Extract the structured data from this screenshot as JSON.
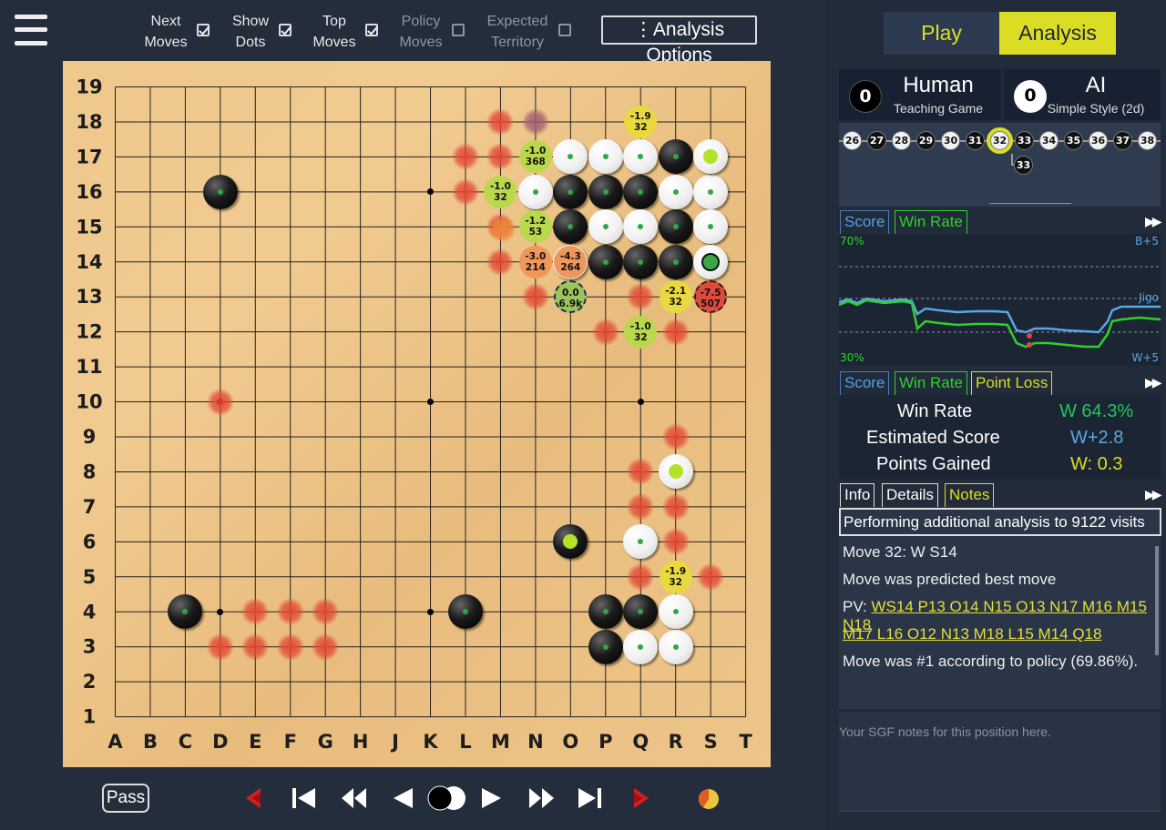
{
  "toolbar": {
    "options": [
      {
        "line1": "Next",
        "line2": "Moves",
        "checked": true
      },
      {
        "line1": "Show",
        "line2": "Dots",
        "checked": true
      },
      {
        "line1": "Top",
        "line2": "Moves",
        "checked": true
      },
      {
        "line1": "Policy",
        "line2": "Moves",
        "checked": false
      },
      {
        "line1": "Expected",
        "line2": "Territory",
        "checked": false
      }
    ],
    "analysis_options": "⋮Analysis Options"
  },
  "board": {
    "columns": [
      "A",
      "B",
      "C",
      "D",
      "E",
      "F",
      "G",
      "H",
      "J",
      "K",
      "L",
      "M",
      "N",
      "O",
      "P",
      "Q",
      "R",
      "S",
      "T"
    ],
    "rows": [
      "19",
      "18",
      "17",
      "16",
      "15",
      "14",
      "13",
      "12",
      "11",
      "10",
      "9",
      "8",
      "7",
      "6",
      "5",
      "4",
      "3",
      "2",
      "1"
    ],
    "hints": [
      {
        "pos": "O13",
        "score": "0.0",
        "visits": "6.9k"
      },
      {
        "pos": "Q18",
        "score": "-1.9",
        "visits": "32"
      },
      {
        "pos": "N17",
        "score": "-1.0",
        "visits": "368"
      },
      {
        "pos": "M16",
        "score": "-1.0",
        "visits": "32"
      },
      {
        "pos": "N15",
        "score": "-1.2",
        "visits": "53"
      },
      {
        "pos": "N14",
        "score": "-3.0",
        "visits": "214"
      },
      {
        "pos": "O14",
        "score": "-4.3",
        "visits": "264"
      },
      {
        "pos": "R13",
        "score": "-2.1",
        "visits": "32"
      },
      {
        "pos": "S13",
        "score": "-7.5",
        "visits": "507"
      },
      {
        "pos": "Q12",
        "score": "-1.0",
        "visits": "32"
      },
      {
        "pos": "R5",
        "score": "-1.9",
        "visits": "32"
      }
    ]
  },
  "controls": {
    "pass": "Pass"
  },
  "tabs": {
    "play": "Play",
    "analysis": "Analysis"
  },
  "players": {
    "black": {
      "captures": "0",
      "name": "Human",
      "subtitle": "Teaching Game"
    },
    "white": {
      "captures": "0",
      "name": "AI",
      "subtitle": "Simple Style (2d)"
    }
  },
  "move_tree": {
    "moves": [
      "26",
      "27",
      "28",
      "29",
      "30",
      "31",
      "32",
      "33",
      "34",
      "35",
      "36",
      "37",
      "38"
    ],
    "branch": "33"
  },
  "graph": {
    "tabs": [
      "Score",
      "Win Rate"
    ],
    "top_left": "70%",
    "top_right": "B+5",
    "mid_right": "Jigo",
    "bottom_left": "30%",
    "bottom_right": "W+5"
  },
  "stats": {
    "tabs": [
      "Score",
      "Win Rate",
      "Point Loss"
    ],
    "win_rate_label": "Win Rate",
    "win_rate": "W 64.3%",
    "score_label": "Estimated Score",
    "score": "W+2.8",
    "points_label": "Points Gained",
    "points": "W: 0.3"
  },
  "info": {
    "tabs": [
      "Info",
      "Details",
      "Notes"
    ],
    "status": "Performing additional analysis to 9122 visits",
    "move": "Move 32: W S14",
    "predicted": "Move was predicted best move",
    "pv_label": "PV:",
    "pv_line1": "WS14 P13 O14 N15 O13 N17 M16 M15 N18",
    "pv_line2": "M17 L16 O12 N13 M18 L15 M14 Q18",
    "policy": "Move was #1 according to policy  (69.86%).",
    "notes_placeholder": "Your SGF notes for this position here."
  },
  "colors": {
    "accent": "#dbdd25",
    "tab_bg": "#2c3a4f",
    "score_line": "#5aa7e4",
    "winrate_line": "#2ed02e",
    "win_text": "#22c65a"
  }
}
